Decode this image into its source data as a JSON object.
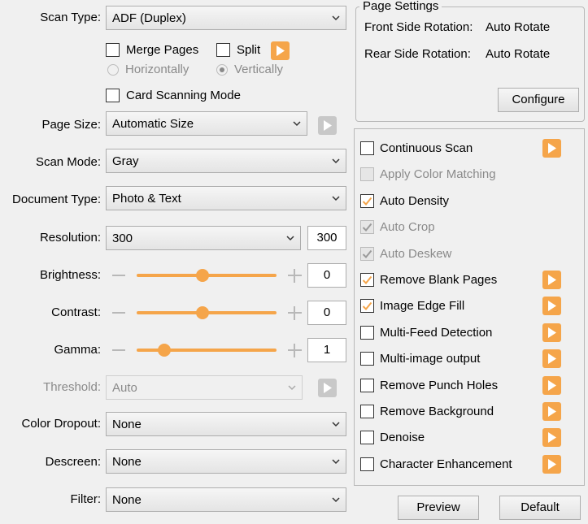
{
  "colors": {
    "accent": "#f5a54a",
    "disabled_text": "#8a8a8a",
    "background": "#f0f0f0"
  },
  "scan_type": {
    "label": "Scan Type:",
    "value": "ADF (Duplex)"
  },
  "merge": {
    "merge_pages_label": "Merge Pages",
    "merge_pages_checked": false,
    "split_label": "Split",
    "split_checked": false,
    "horizontally_label": "Horizontally",
    "horizontally_selected": false,
    "vertically_label": "Vertically",
    "vertically_selected": true
  },
  "card_scanning": {
    "label": "Card Scanning Mode",
    "checked": false
  },
  "page_size": {
    "label": "Page Size:",
    "value": "Automatic Size"
  },
  "scan_mode": {
    "label": "Scan Mode:",
    "value": "Gray"
  },
  "document_type": {
    "label": "Document Type:",
    "value": "Photo & Text"
  },
  "resolution": {
    "label": "Resolution:",
    "value": "300",
    "number": "300"
  },
  "brightness": {
    "label": "Brightness:",
    "value": "0",
    "slider_fraction": 0.47
  },
  "contrast": {
    "label": "Contrast:",
    "value": "0",
    "slider_fraction": 0.47
  },
  "gamma": {
    "label": "Gamma:",
    "value": "1",
    "slider_fraction": 0.2
  },
  "threshold": {
    "label": "Threshold:",
    "value": "Auto",
    "disabled": true
  },
  "color_dropout": {
    "label": "Color Dropout:",
    "value": "None"
  },
  "descreen": {
    "label": "Descreen:",
    "value": "None"
  },
  "filter": {
    "label": "Filter:",
    "value": "None"
  },
  "page_settings": {
    "title": "Page Settings",
    "front_label": "Front Side Rotation:",
    "front_value": "Auto Rotate",
    "rear_label": "Rear Side Rotation:",
    "rear_value": "Auto Rotate",
    "configure_label": "Configure"
  },
  "options": [
    {
      "label": "Continuous Scan",
      "checked": false,
      "disabled": false,
      "has_button": true
    },
    {
      "label": "Apply Color Matching",
      "checked": false,
      "disabled": true,
      "has_button": false
    },
    {
      "label": "Auto Density",
      "checked": true,
      "disabled": false,
      "has_button": false
    },
    {
      "label": "Auto Crop",
      "checked": true,
      "disabled": true,
      "has_button": false
    },
    {
      "label": "Auto Deskew",
      "checked": true,
      "disabled": true,
      "has_button": false
    },
    {
      "label": "Remove Blank Pages",
      "checked": true,
      "disabled": false,
      "has_button": true
    },
    {
      "label": "Image Edge Fill",
      "checked": true,
      "disabled": false,
      "has_button": true
    },
    {
      "label": "Multi-Feed Detection",
      "checked": false,
      "disabled": false,
      "has_button": true
    },
    {
      "label": "Multi-image output",
      "checked": false,
      "disabled": false,
      "has_button": true
    },
    {
      "label": "Remove Punch Holes",
      "checked": false,
      "disabled": false,
      "has_button": true
    },
    {
      "label": "Remove Background",
      "checked": false,
      "disabled": false,
      "has_button": true
    },
    {
      "label": "Denoise",
      "checked": false,
      "disabled": false,
      "has_button": true
    },
    {
      "label": "Character Enhancement",
      "checked": false,
      "disabled": false,
      "has_button": true
    }
  ],
  "footer": {
    "preview_label": "Preview",
    "default_label": "Default"
  },
  "icons": {
    "chevron": "chevron-down-icon",
    "play": "play-icon",
    "check": "checkmark-icon"
  }
}
